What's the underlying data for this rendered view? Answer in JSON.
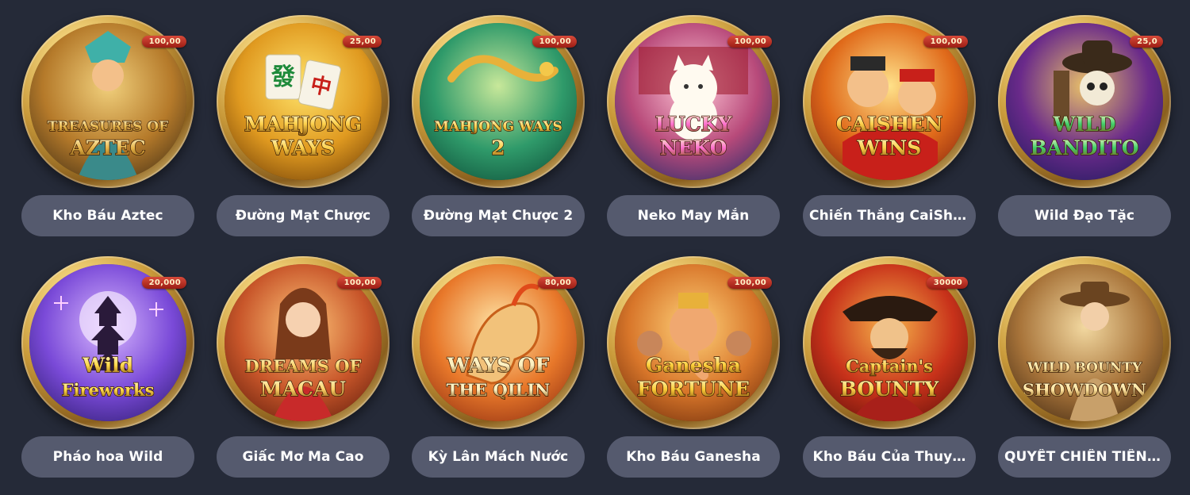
{
  "games": [
    {
      "id": "aztec",
      "title": "Kho Báu Aztec",
      "logo": "TREASURES OF AZTEC",
      "bg": [
        "#3a2a14",
        "#b57a2a",
        "#f1d07c"
      ],
      "accent": "#e8b64a",
      "badge": "100,00",
      "icon": "aztec-queen-icon"
    },
    {
      "id": "mahjong-ways",
      "title": "Đường Mạt Chược",
      "logo": "MAHJONG WAYS",
      "bg": [
        "#6a3a06",
        "#e09a20",
        "#ffe36a"
      ],
      "accent": "#ffd14a",
      "badge": "25,00",
      "icon": "mahjong-tiles-icon"
    },
    {
      "id": "mahjong-ways-2",
      "title": "Đường Mạt Chược 2",
      "logo": "MAHJONG WAYS 2",
      "bg": [
        "#0c4a36",
        "#2f9a6a",
        "#c8e89a"
      ],
      "accent": "#ffcf4a",
      "badge": "100,00",
      "icon": "golden-dragon-icon"
    },
    {
      "id": "lucky-neko",
      "title": "Neko May Mắn",
      "logo": "LUCKY NEKO",
      "bg": [
        "#1e2a6a",
        "#b84a7a",
        "#ffc6d6"
      ],
      "accent": "#ff6fd0",
      "badge": "100,00",
      "icon": "lucky-cat-icon"
    },
    {
      "id": "caishen-wins",
      "title": "Chiến Thắng CaiShen",
      "logo": "CAISHEN WINS",
      "bg": [
        "#7a1a0e",
        "#e06a1a",
        "#ffe28a"
      ],
      "accent": "#ffd04a",
      "badge": "100,00",
      "icon": "caishen-god-icon"
    },
    {
      "id": "wild-bandito",
      "title": "Wild Đạo Tặc",
      "logo": "WILD BANDITO",
      "bg": [
        "#1a1a5a",
        "#6a2a8a",
        "#e8c06a"
      ],
      "accent": "#3fd06a",
      "badge": "25,0",
      "icon": "skeleton-bandit-icon"
    },
    {
      "id": "wild-fireworks",
      "title": "Pháo hoa Wild",
      "logo": "Wild Fireworks",
      "bg": [
        "#2a1a6a",
        "#7a4ad8",
        "#d9b8ff"
      ],
      "accent": "#ffd94a",
      "badge": "20,000",
      "icon": "pagoda-fireworks-icon"
    },
    {
      "id": "dreams-of-macau",
      "title": "Giấc Mơ Ma Cao",
      "logo": "DREAMS OF MACAU",
      "bg": [
        "#5a1a0a",
        "#c8562a",
        "#ffc77a"
      ],
      "accent": "#ffd36a",
      "badge": "100,00",
      "icon": "macau-lady-icon"
    },
    {
      "id": "ways-of-qilin",
      "title": "Kỳ Lân Mách Nước",
      "logo": "WAYS OF THE QILIN",
      "bg": [
        "#8a2a10",
        "#e8782a",
        "#ffe6a8"
      ],
      "accent": "#fff0c0",
      "badge": "80,00",
      "icon": "qilin-icon"
    },
    {
      "id": "ganesha-fortune",
      "title": "Kho Báu Ganesha",
      "logo": "Ganesha FORTUNE",
      "bg": [
        "#6a2a0a",
        "#d8762a",
        "#ffd27a"
      ],
      "accent": "#ffcf3a",
      "badge": "100,00",
      "icon": "ganesha-icon"
    },
    {
      "id": "captains-bounty",
      "title": "Kho Báu Của Thuy…",
      "logo": "Captain's BOUNTY",
      "bg": [
        "#5a0e0a",
        "#c8321a",
        "#f6b24a"
      ],
      "accent": "#ffcf4a",
      "badge": "30000",
      "icon": "pirate-captain-icon"
    },
    {
      "id": "wild-bounty-showdown",
      "title": "QUYẾT CHIẾN TIỀN …",
      "logo": "WILD BOUNTY SHOWDOWN",
      "bg": [
        "#3a2410",
        "#a8743a",
        "#f2d8a0"
      ],
      "accent": "#ffe4a0",
      "badge": "",
      "icon": "cowgirl-icon"
    }
  ]
}
